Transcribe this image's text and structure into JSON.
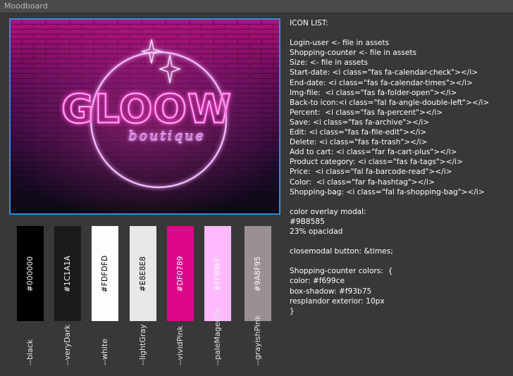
{
  "window": {
    "title": "Moodboard"
  },
  "artboard": {
    "logo_main": "GLOOW",
    "logo_sub": "boutique"
  },
  "swatches": [
    {
      "hex": "#000000",
      "var": "--black",
      "bg": "#000000",
      "fg": "#ffffff"
    },
    {
      "hex": "#1C1A1A",
      "var": "--veryDark",
      "bg": "#1c1a1a",
      "fg": "#ffffff"
    },
    {
      "hex": "#FDFDFD",
      "var": "--white",
      "bg": "#fdfdfd",
      "fg": "#000000"
    },
    {
      "hex": "#E8E8E8",
      "var": "--lightGray",
      "bg": "#e8e8e8",
      "fg": "#000000"
    },
    {
      "hex": "#DF0789",
      "var": "--vividPink",
      "bg": "#df0789",
      "fg": "#ffffff"
    },
    {
      "hex": "#FFB9FF",
      "var": "--paleMagenta",
      "bg": "#ffb9ff",
      "fg": "#ffffff"
    },
    {
      "hex": "#9A8F95",
      "var": "--grayishPink",
      "bg": "#9a8f95",
      "fg": "#ffffff"
    }
  ],
  "notes": {
    "lines": [
      "ICON LIST:",
      "",
      "Login-user <- file in assets",
      "Shopping-counter <- file in assets",
      "Size: <- file in assets",
      "Start-date: <i class=\"fas fa-calendar-check\"></i>",
      "End-date: <i class=\"fas fa-calendar-times\"></i>",
      "Img-file:  <i class=\"fas fa-folder-open\"></i>",
      "Back-to icon:<i class=\"fal fa-angle-double-left\"></i>",
      "Percent:  <i class=\"fas fa-percent\"></i>",
      "Save: <i class=\"fas fa-archive\"></i>",
      "Edit: <i class=\"fas fa-file-edit\"></i>",
      "Delete: <i class=\"fas fa-trash\"></i>",
      "Add to cart: <i class=\"far fa-cart-plus\"></i>",
      "Product category: <i class=\"fas fa-tags\"></i>",
      "Price:  <i class=\"fal fa-barcode-read\"></i>",
      "Color:  <i class=\"far fa-hashtag\"></i>",
      "Shopping-bag: <i class=\"fal fa-shopping-bag\"></i>",
      "",
      "color overlay modal:",
      "#9B8585",
      "23% opacidad",
      "",
      "closemodal button: &times;",
      "",
      "Shopping-counter colors:  {",
      "color: #f699ce",
      "box-shadow: #f93b75",
      "resplandor exterior: 10px",
      "}"
    ]
  }
}
